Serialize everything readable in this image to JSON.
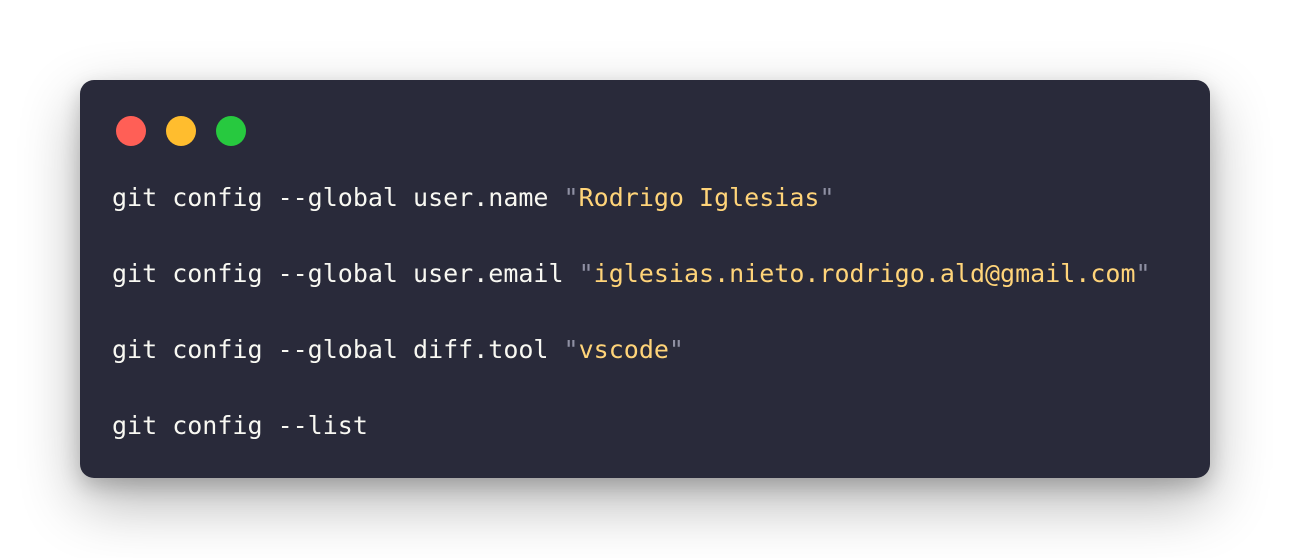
{
  "colors": {
    "page_background": "#ffffff",
    "window_background": "#292a3a",
    "plain_text": "#f8f8f2",
    "string_text": "#ffd479",
    "quote_mark": "#8f90a3",
    "close_dot": "#ff5f56",
    "minimize_dot": "#ffbd2e",
    "maximize_dot": "#27c93f"
  },
  "window_controls": [
    {
      "name": "close-dot",
      "color": "#ff5f56"
    },
    {
      "name": "minimize-dot",
      "color": "#ffbd2e"
    },
    {
      "name": "maximize-dot",
      "color": "#27c93f"
    }
  ],
  "code": {
    "lines": [
      {
        "command": "git config --global user.name ",
        "quote_open": "\"",
        "string": "Rodrigo Iglesias",
        "quote_close": "\""
      },
      {
        "command": "git config --global user.email ",
        "quote_open": "\"",
        "string": "iglesias.nieto.rodrigo.ald@gmail.com",
        "quote_close": "\""
      },
      {
        "command": "git config --global diff.tool ",
        "quote_open": "\"",
        "string": "vscode",
        "quote_close": "\""
      },
      {
        "command": "git config --list",
        "quote_open": "",
        "string": "",
        "quote_close": ""
      }
    ]
  }
}
